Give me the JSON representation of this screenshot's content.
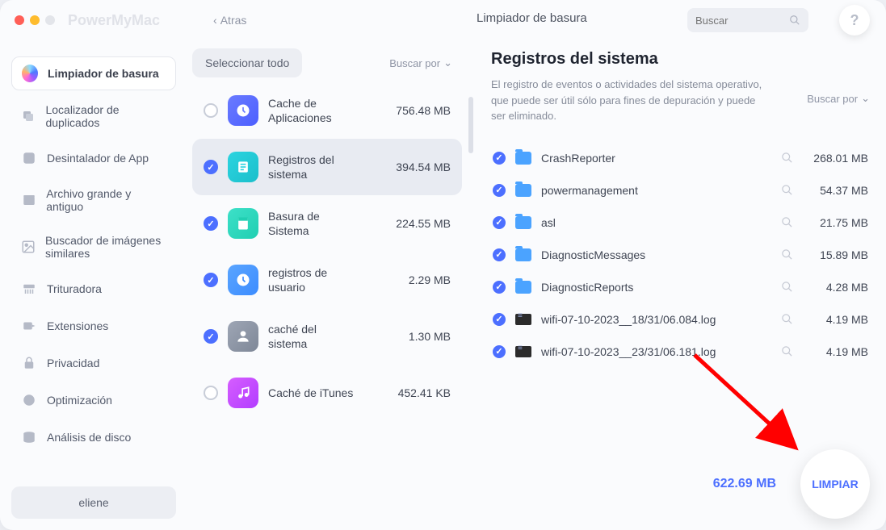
{
  "app_title": "PowerMyMac",
  "back_label": "Atras",
  "top_title": "Limpiador de basura",
  "search": {
    "placeholder": "Buscar"
  },
  "help_glyph": "?",
  "sidebar": {
    "items": [
      {
        "label": "Limpiador de basura"
      },
      {
        "label": "Localizador de duplicados"
      },
      {
        "label": "Desintalador de App"
      },
      {
        "label": "Archivo grande y antiguo"
      },
      {
        "label": "Buscador de imágenes similares"
      },
      {
        "label": "Trituradora"
      },
      {
        "label": "Extensiones"
      },
      {
        "label": "Privacidad"
      },
      {
        "label": "Optimización"
      },
      {
        "label": "Análisis de disco"
      }
    ],
    "user": "eliene"
  },
  "mid": {
    "select_all": "Seleccionar todo",
    "sort_by": "Buscar por",
    "items": [
      {
        "label": "Cache de Aplicaciones",
        "size": "756.48 MB"
      },
      {
        "label": "Registros del sistema",
        "size": "394.54 MB"
      },
      {
        "label": "Basura de Sistema",
        "size": "224.55 MB"
      },
      {
        "label": "registros de usuario",
        "size": "2.29 MB"
      },
      {
        "label": "caché del sistema",
        "size": "1.30 MB"
      },
      {
        "label": "Caché de iTunes",
        "size": "452.41 KB"
      }
    ]
  },
  "detail": {
    "title": "Registros del sistema",
    "desc": "El registro de eventos o actividades del sistema operativo, que puede ser útil sólo para fines de depuración y puede ser eliminado.",
    "sort_by": "Buscar por",
    "rows": [
      {
        "type": "folder",
        "name": "CrashReporter",
        "size": "268.01 MB"
      },
      {
        "type": "folder",
        "name": "powermanagement",
        "size": "54.37 MB"
      },
      {
        "type": "folder",
        "name": "asl",
        "size": "21.75 MB"
      },
      {
        "type": "folder",
        "name": "DiagnosticMessages",
        "size": "15.89 MB"
      },
      {
        "type": "folder",
        "name": "DiagnosticReports",
        "size": "4.28 MB"
      },
      {
        "type": "file",
        "name": "wifi-07-10-2023__18/31/06.084.log",
        "size": "4.19 MB"
      },
      {
        "type": "file",
        "name": "wifi-07-10-2023__23/31/06.181.log",
        "size": "4.19 MB"
      }
    ]
  },
  "footer": {
    "total": "622.69 MB",
    "clean": "LIMPIAR"
  }
}
